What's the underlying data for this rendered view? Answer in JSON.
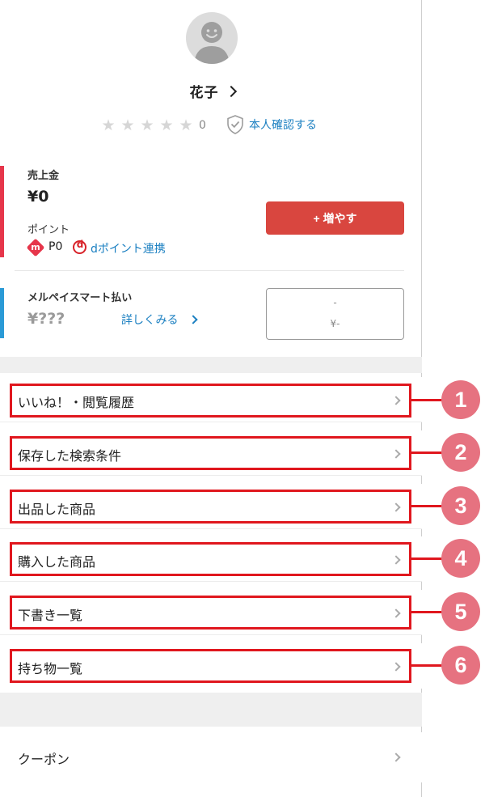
{
  "profile": {
    "name": "花子",
    "rating_count": "0",
    "verify_label": "本人確認する"
  },
  "balance": {
    "sales_label": "売上金",
    "sales_amount": "¥0",
    "points_label": "ポイント",
    "merpoint_icon": "m",
    "points_value": "P0",
    "dpoint_icon": "d",
    "dpoint_link": "dポイント連携",
    "increase_button": "+ 増やす"
  },
  "smart_pay": {
    "label": "メルペイスマート払い",
    "amount": "¥???",
    "details_link": "詳しくみる",
    "box_line1": "-",
    "box_line2": "¥-"
  },
  "menu": {
    "items": [
      {
        "label": "いいね！・閲覧履歴",
        "number": "1"
      },
      {
        "label": "保存した検索条件",
        "number": "2"
      },
      {
        "label": "出品した商品",
        "number": "3"
      },
      {
        "label": "購入した商品",
        "number": "4"
      },
      {
        "label": "下書き一覧",
        "number": "5"
      },
      {
        "label": "持ち物一覧",
        "number": "6"
      }
    ],
    "coupon": "クーポン"
  },
  "colors": {
    "highlight": "#e0171e",
    "number_badge": "#e67280",
    "accent_red": "#d9463f",
    "link_blue": "#1a7fc1"
  }
}
